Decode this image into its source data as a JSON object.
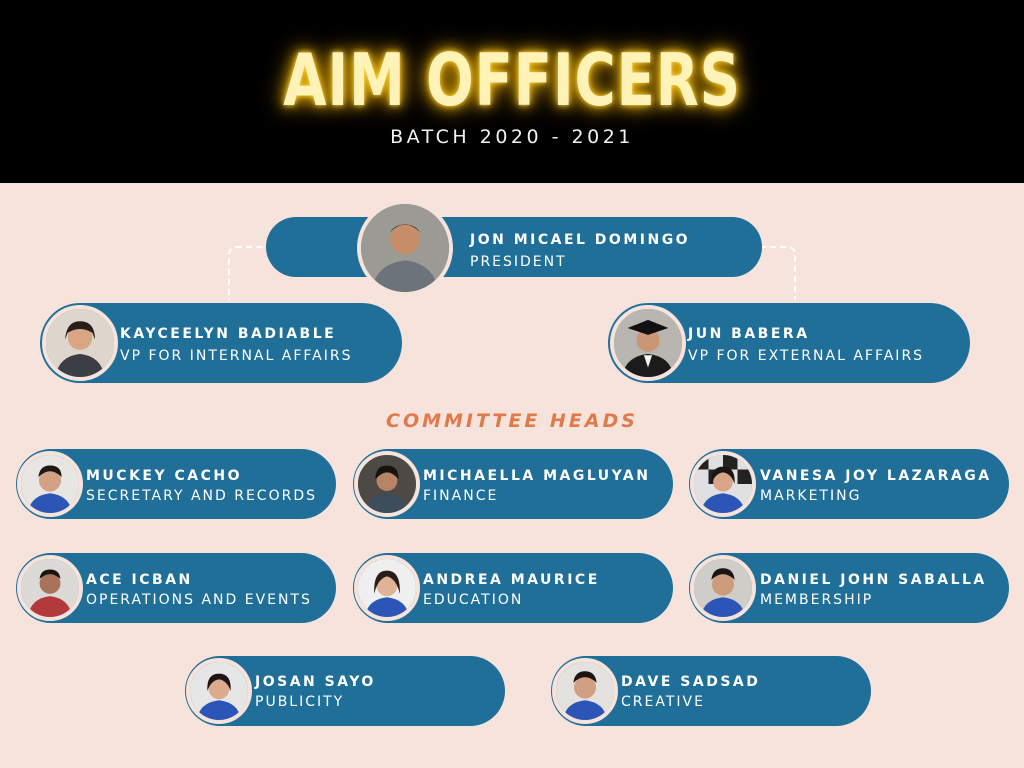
{
  "header": {
    "title": "AIM OFFICERS",
    "subtitle": "BATCH 2020 - 2021"
  },
  "president": {
    "name": "JON MICAEL DOMINGO",
    "role": "PRESIDENT"
  },
  "vps": [
    {
      "name": "KAYCEELYN BADIABLE",
      "role": "VP FOR INTERNAL AFFAIRS"
    },
    {
      "name": "JUN BABERA",
      "role": "VP FOR EXTERNAL AFFAIRS"
    }
  ],
  "committee": {
    "heading": "COMMITTEE HEADS",
    "members": [
      {
        "name": "MUCKEY CACHO",
        "role": "SECRETARY AND RECORDS"
      },
      {
        "name": "MICHAELLA MAGLUYAN",
        "role": "FINANCE"
      },
      {
        "name": "VANESA  JOY LAZARAGA",
        "role": "MARKETING"
      },
      {
        "name": "ACE ICBAN",
        "role": "OPERATIONS AND EVENTS"
      },
      {
        "name": "ANDREA MAURICE",
        "role": "EDUCATION"
      },
      {
        "name": "DANIEL JOHN SABALLA",
        "role": "MEMBERSHIP"
      },
      {
        "name": "JOSAN  SAYO",
        "role": "PUBLICITY"
      },
      {
        "name": "DAVE SADSAD",
        "role": "CREATIVE"
      }
    ]
  },
  "colors": {
    "pill": "#1f6f99",
    "background": "#f6e3dc",
    "heading_accent": "#e07a4a",
    "title_glow": "#ffd84a"
  }
}
